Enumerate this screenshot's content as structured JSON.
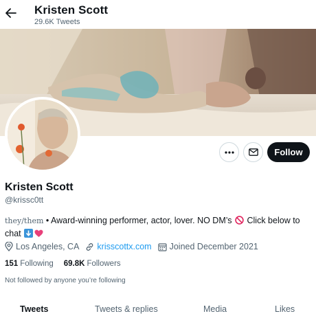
{
  "header": {
    "name": "Kristen Scott",
    "tweet_count": "29.6K Tweets"
  },
  "profile": {
    "display_name": "Kristen Scott",
    "handle": "@krissc0tt",
    "bio_pronouns": "they/them",
    "bio_text": " • Award-winning performer, actor, lover. NO DM’s ",
    "bio_text_2": " Click below to chat ",
    "location": "Los Angeles, CA",
    "website": "krisscottx.com",
    "joined": "Joined December 2021",
    "following_count": "151",
    "following_label": "Following",
    "followers_count": "69.8K",
    "followers_label": "Followers",
    "followed_note": "Not followed by anyone you’re following"
  },
  "actions": {
    "follow_label": "Follow",
    "more_icon": "more-icon",
    "message_icon": "mail-icon"
  },
  "tabs": [
    {
      "label": "Tweets",
      "active": true
    },
    {
      "label": "Tweets & replies",
      "active": false
    },
    {
      "label": "Media",
      "active": false
    },
    {
      "label": "Likes",
      "active": false
    }
  ],
  "colors": {
    "link": "#1d9bf0",
    "follow_button": "#0f1419",
    "secondary_text": "#536471"
  }
}
